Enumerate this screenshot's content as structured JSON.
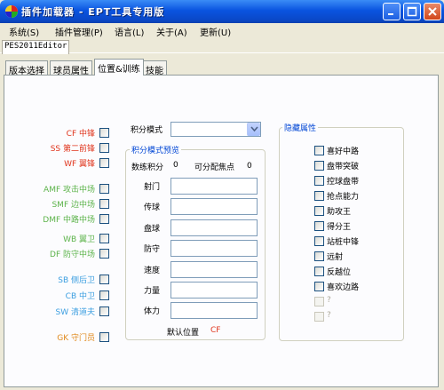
{
  "window": {
    "title": "插件加载器 - EPT工具专用版",
    "controls": {
      "minimize": "minimize-icon",
      "maximize": "maximize-icon",
      "close": "close-icon"
    }
  },
  "menu": [
    "系统(S)",
    "插件管理(P)",
    "语言(L)",
    "关于(A)",
    "更新(U)"
  ],
  "doc_tab": "PES2011Editor",
  "tabs": [
    "版本选择",
    "球员属性",
    "位置&训练",
    "技能"
  ],
  "active_tab": "位置&训练",
  "positions": [
    {
      "label": "CF 中锋",
      "color": "red"
    },
    {
      "label": "SS 第二前锋",
      "color": "red"
    },
    {
      "label": "WF 翼锋",
      "color": "red"
    },
    {
      "label": "AMF 攻击中场",
      "color": "green"
    },
    {
      "label": "SMF 边中场",
      "color": "green"
    },
    {
      "label": "DMF 中路中场",
      "color": "green"
    },
    {
      "label": "WB 翼卫",
      "color": "green"
    },
    {
      "label": "DF 防守中场",
      "color": "green"
    },
    {
      "label": "SB 侧后卫",
      "color": "blue"
    },
    {
      "label": "CB 中卫",
      "color": "blue"
    },
    {
      "label": "SW 清道夫",
      "color": "blue"
    },
    {
      "label": "GK 守门员",
      "color": "orange"
    }
  ],
  "score_mode": {
    "label": "积分模式",
    "value": ""
  },
  "preview": {
    "title": "积分模式预览",
    "level_label": "数练积分",
    "level_value": "0",
    "alloc_label": "可分配焦点",
    "alloc_value": "0",
    "fields": [
      "射门",
      "传球",
      "盘球",
      "防守",
      "速度",
      "力量",
      "体力"
    ],
    "default_pos_label": "默认位置",
    "default_pos_value": "CF"
  },
  "hidden_attrs": {
    "title": "隐藏属性",
    "items": [
      "喜好中路",
      "盘带突破",
      "控球盘带",
      "抢点能力",
      "助攻王",
      "得分王",
      "站桩中锋",
      "远射",
      "反越位",
      "喜欢边路",
      "?",
      "?"
    ]
  },
  "colors": {
    "red": "#e0341c",
    "green": "#5cb34a",
    "blue": "#3b9ee0",
    "orange": "#e08a1e",
    "title_blue": "#0046d5"
  }
}
